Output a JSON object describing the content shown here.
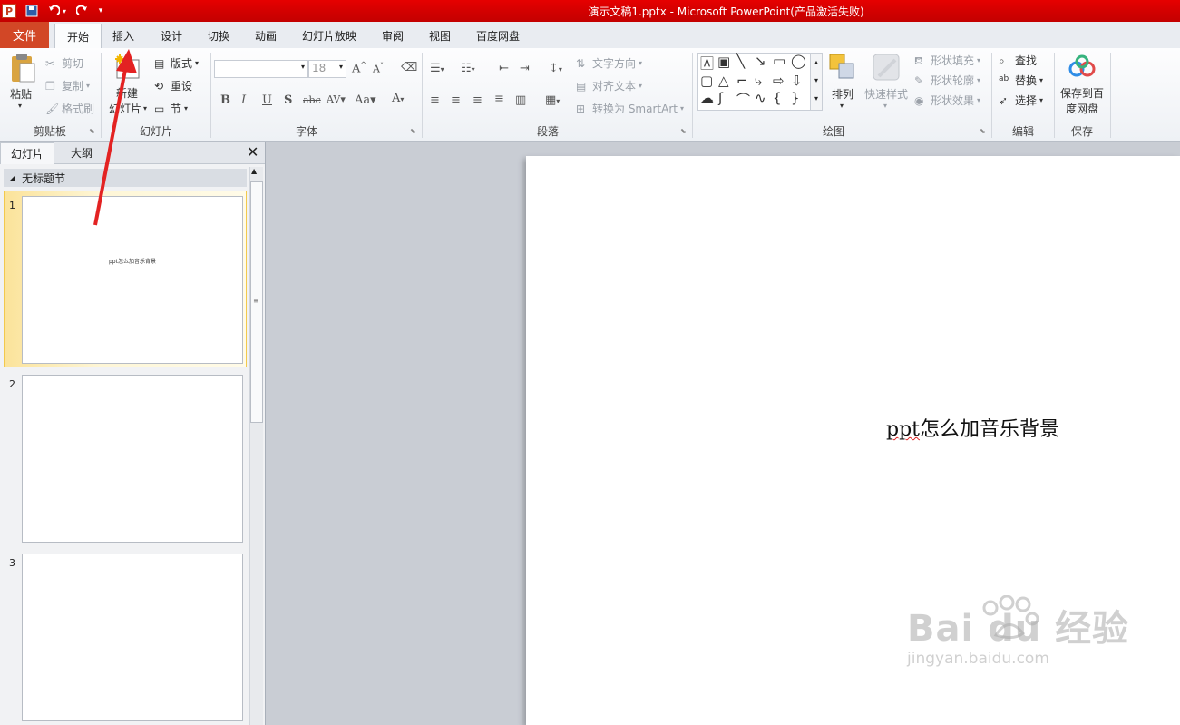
{
  "window": {
    "title": "演示文稿1.pptx - Microsoft PowerPoint(产品激活失败)",
    "accent": "#d00000"
  },
  "tabs": {
    "file": "文件",
    "items": [
      "开始",
      "插入",
      "设计",
      "切换",
      "动画",
      "幻灯片放映",
      "审阅",
      "视图",
      "百度网盘"
    ],
    "active": "开始"
  },
  "ribbon": {
    "clipboard": {
      "label": "剪贴板",
      "paste": "粘贴",
      "cut": "剪切",
      "copy": "复制",
      "format_painter": "格式刷"
    },
    "slides": {
      "label": "幻灯片",
      "new_slide_1": "新建",
      "new_slide_2": "幻灯片",
      "layout": "版式",
      "reset": "重设",
      "section": "节"
    },
    "font": {
      "label": "字体",
      "font_name": "",
      "font_size": "18"
    },
    "paragraph": {
      "label": "段落",
      "text_direction": "文字方向",
      "align_text": "对齐文本",
      "convert_smartart": "转换为 SmartArt"
    },
    "drawing": {
      "label": "绘图",
      "arrange": "排列",
      "quick_styles": "快速样式",
      "shape_fill": "形状填充",
      "shape_outline": "形状轮廓",
      "shape_effects": "形状效果"
    },
    "editing": {
      "label": "编辑",
      "find": "查找",
      "replace": "替换",
      "select": "选择"
    },
    "save": {
      "label": "保存",
      "save_baidu_1": "保存到百",
      "save_baidu_2": "度网盘"
    }
  },
  "left_pane": {
    "tabs": [
      "幻灯片",
      "大纲"
    ],
    "section_name": "无标题节",
    "thumbnails": [
      {
        "number": "1",
        "text": "ppt怎么加音乐背景"
      },
      {
        "number": "2",
        "text": ""
      },
      {
        "number": "3",
        "text": ""
      }
    ]
  },
  "slide": {
    "text": "怎么加音乐背景",
    "text_prefix": "ppt"
  },
  "watermark": {
    "brand": "Bai du 经验",
    "url": "jingyan.baidu.com"
  },
  "annotation": {
    "type": "red-arrow",
    "points_to": "插入"
  }
}
